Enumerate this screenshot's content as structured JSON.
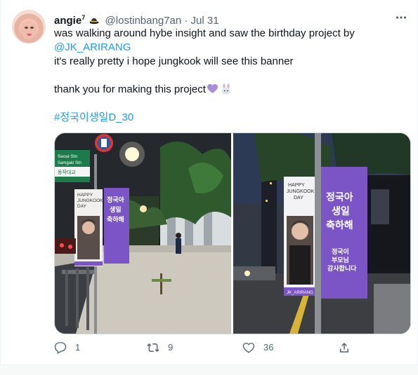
{
  "tweet": {
    "author": {
      "name": "angie",
      "superscript": "7",
      "handle": "@lostinbang7an",
      "separator": "·",
      "date": "Jul 31"
    },
    "lines": [
      "was walking around hybe insight and saw the birthday project by",
      "@JK_ARIRANG",
      "it's really pretty i hope jungkook will see this banner",
      "thank you for making this project",
      "#정국이생일D_30"
    ],
    "emojis": [
      "purple-heart",
      "rabbit"
    ],
    "photos": {
      "left": {
        "sign_top": "Seoul Stn",
        "sign_top2": "Samgaki Stn",
        "sign_korean": "동작대교",
        "banner_white": [
          "HAPPY",
          "JUNGKOOK",
          "DAY"
        ],
        "banner_purple": [
          "정국아",
          "생일",
          "축하해"
        ]
      },
      "right": {
        "banner_white": [
          "HAPPY",
          "JUNGKOOK",
          "DAY"
        ],
        "banner_white_footer": "JK_ARIRANG",
        "banner_purple": [
          "정국아",
          "생일",
          "축하해"
        ],
        "banner_purple_sub": [
          "정국이",
          "부모님",
          "감사합니다"
        ]
      }
    },
    "actions": {
      "replies": "1",
      "retweets": "9",
      "likes": "36"
    },
    "colors": {
      "link": "#1d9bf0",
      "muted": "#536471",
      "banner_purple": "#7b55c6"
    }
  }
}
